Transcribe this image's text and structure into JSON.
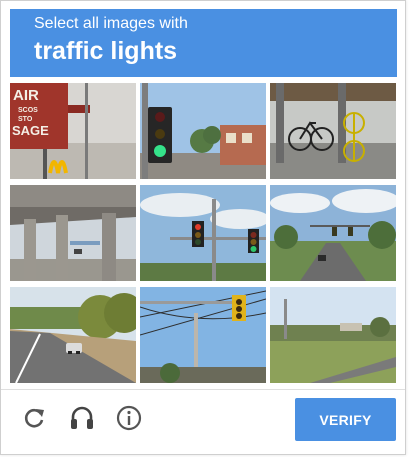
{
  "header": {
    "instruction": "Select all images with",
    "target_object": "traffic lights",
    "background_color": "#4a90e2"
  },
  "tiles": [
    {
      "scene": "sign-with-golden-arches",
      "sign_text": [
        "AIR",
        "SCOS",
        "STO",
        "SAGE"
      ]
    },
    {
      "scene": "traffic-light-green"
    },
    {
      "scene": "bicycles-on-sidewalk"
    },
    {
      "scene": "highway-overpass"
    },
    {
      "scene": "traffic-lights-on-pole"
    },
    {
      "scene": "road-with-traffic-lights"
    },
    {
      "scene": "rural-road-with-car"
    },
    {
      "scene": "traffic-light-with-power-lines"
    },
    {
      "scene": "roadside-field"
    }
  ],
  "footer": {
    "reload_icon": "reload-icon",
    "audio_icon": "headphones-icon",
    "info_icon": "info-icon",
    "verify_label": "VERIFY",
    "verify_color": "#4a90e2"
  }
}
